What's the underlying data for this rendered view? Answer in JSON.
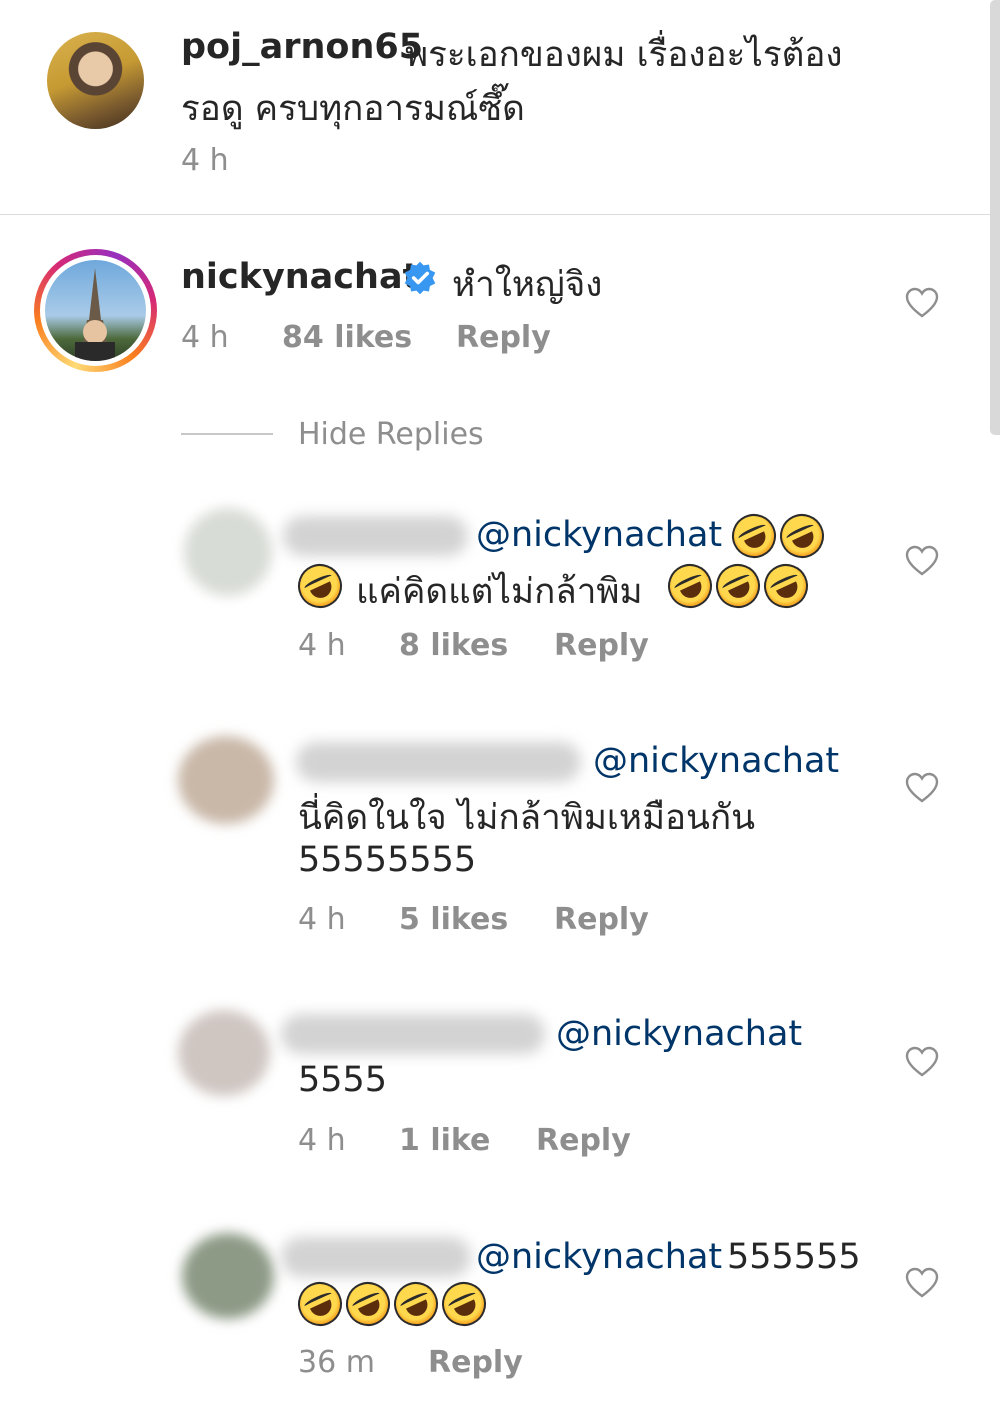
{
  "caption": {
    "username": "poj_arnon65",
    "text_line1": "พระเอกของผม เรื่องอะไรต้อง",
    "text_line2": "รอดู ครบทุกอารมณ์ซึ๊ด",
    "time": "4 h"
  },
  "comment": {
    "username": "nickynachat",
    "text": "หำใหญ่จิง",
    "time": "4 h",
    "likes": "84 likes",
    "reply": "Reply",
    "hide_replies": "Hide Replies"
  },
  "replies": [
    {
      "mention": "@nickynachat",
      "text": "แค่คิดแต่ไม่กล้าพิม",
      "time": "4 h",
      "likes": "8 likes",
      "reply": "Reply"
    },
    {
      "mention": "@nickynachat",
      "text_line1": "นี่คิดในใจ ไม่กล้าพิมเหมือนกัน",
      "text_line2": "55555555",
      "time": "4 h",
      "likes": "5 likes",
      "reply": "Reply"
    },
    {
      "mention": "@nickynachat",
      "text": "5555",
      "time": "4 h",
      "likes": "1 like",
      "reply": "Reply"
    },
    {
      "mention": "@nickynachat",
      "text": "555555",
      "time": "36 m",
      "reply": "Reply"
    }
  ],
  "icons": {
    "like": "heart-outline-icon",
    "verified": "verified-badge-icon",
    "emoji": "rolling-on-floor-laughing-emoji"
  },
  "colors": {
    "mention": "#003569",
    "meta": "#8e8e8e",
    "verified": "#3897f0"
  }
}
